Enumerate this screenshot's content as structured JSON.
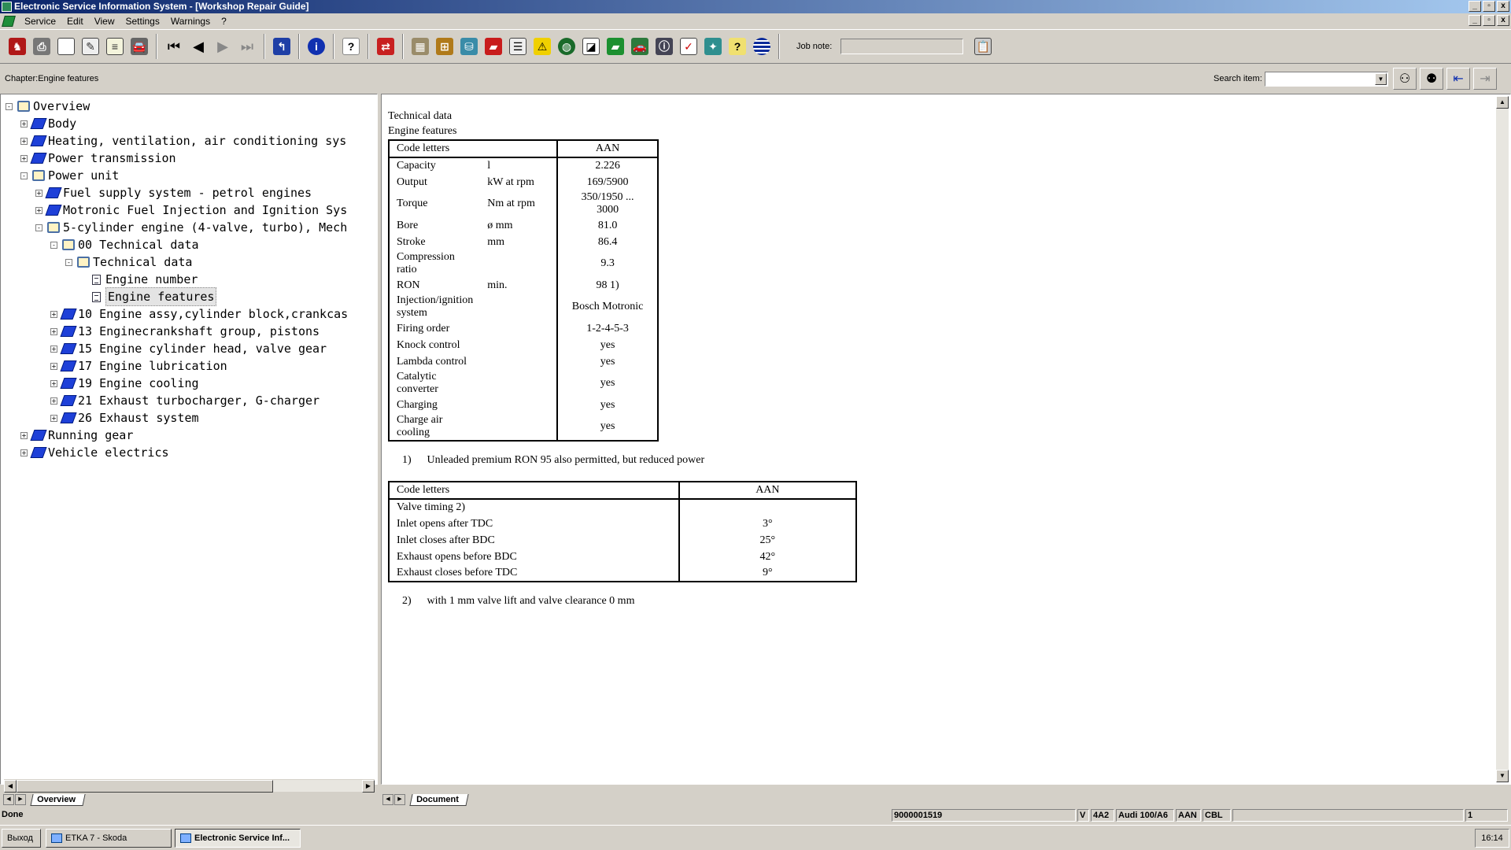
{
  "window": {
    "title": "Electronic Service Information System - [Workshop Repair Guide]",
    "min": "_",
    "restore": "▫",
    "close": "x"
  },
  "menu": [
    "Service",
    "Edit",
    "View",
    "Settings",
    "Warnings",
    "?"
  ],
  "toolbar": {
    "job_note_label": "Job note:",
    "job_note_value": ""
  },
  "chapter_bar": {
    "chapter": "Chapter:Engine features",
    "search_label": "Search item:",
    "search_value": ""
  },
  "tree": [
    {
      "label": "Overview",
      "level": 0,
      "toggle": "-",
      "icon": "open"
    },
    {
      "label": "Body",
      "level": 1,
      "toggle": "+",
      "icon": "closed"
    },
    {
      "label": "Heating, ventilation, air conditioning sys",
      "level": 1,
      "toggle": "+",
      "icon": "closed"
    },
    {
      "label": "Power transmission",
      "level": 1,
      "toggle": "+",
      "icon": "closed"
    },
    {
      "label": "Power unit",
      "level": 1,
      "toggle": "-",
      "icon": "open"
    },
    {
      "label": "Fuel supply system - petrol engines",
      "level": 2,
      "toggle": "+",
      "icon": "closed"
    },
    {
      "label": "Motronic Fuel Injection and Ignition Sys",
      "level": 2,
      "toggle": "+",
      "icon": "closed"
    },
    {
      "label": "5-cylinder engine (4-valve, turbo), Mech",
      "level": 2,
      "toggle": "-",
      "icon": "open"
    },
    {
      "label": "00 Technical data",
      "level": 3,
      "toggle": "-",
      "icon": "open"
    },
    {
      "label": "Technical data",
      "level": 4,
      "toggle": "-",
      "icon": "open"
    },
    {
      "label": "Engine number",
      "level": 5,
      "toggle": "",
      "icon": "doc"
    },
    {
      "label": "Engine features",
      "level": 5,
      "toggle": "",
      "icon": "doc",
      "selected": true
    },
    {
      "label": "10 Engine assy,cylinder block,crankcas",
      "level": 3,
      "toggle": "+",
      "icon": "closed"
    },
    {
      "label": "13 Enginecrankshaft group, pistons",
      "level": 3,
      "toggle": "+",
      "icon": "closed"
    },
    {
      "label": "15 Engine cylinder head, valve gear",
      "level": 3,
      "toggle": "+",
      "icon": "closed"
    },
    {
      "label": "17 Engine lubrication",
      "level": 3,
      "toggle": "+",
      "icon": "closed"
    },
    {
      "label": "19 Engine cooling",
      "level": 3,
      "toggle": "+",
      "icon": "closed"
    },
    {
      "label": "21 Exhaust turbocharger, G-charger",
      "level": 3,
      "toggle": "+",
      "icon": "closed"
    },
    {
      "label": "26 Exhaust system",
      "level": 3,
      "toggle": "+",
      "icon": "closed"
    },
    {
      "label": "Running gear",
      "level": 1,
      "toggle": "+",
      "icon": "closed"
    },
    {
      "label": "Vehicle electrics",
      "level": 1,
      "toggle": "+",
      "icon": "closed"
    }
  ],
  "left_tab": "Overview",
  "right_tab": "Document",
  "document": {
    "heading1": "Technical data",
    "heading2": "Engine features",
    "table1": {
      "header": [
        "Code letters",
        "",
        "AAN"
      ],
      "rows": [
        [
          "Capacity",
          "l",
          "2.226"
        ],
        [
          "Output",
          "kW at rpm",
          "169/5900"
        ],
        [
          "Torque",
          "Nm at rpm",
          "350/1950 ...\n3000"
        ],
        [
          "Bore",
          "ø mm",
          "81.0"
        ],
        [
          "Stroke",
          "mm",
          "86.4"
        ],
        [
          "Compression ratio",
          "",
          "9.3"
        ],
        [
          "RON",
          "min.",
          "98 1)"
        ],
        [
          "Injection/ignition system",
          "",
          "Bosch Motronic"
        ],
        [
          "Firing order",
          "",
          "1-2-4-5-3"
        ],
        [
          "Knock control",
          "",
          "yes"
        ],
        [
          "Lambda control",
          "",
          "yes"
        ],
        [
          "Catalytic converter",
          "",
          "yes"
        ],
        [
          "Charging",
          "",
          "yes"
        ],
        [
          "Charge air cooling",
          "",
          "yes"
        ]
      ]
    },
    "footnote1": {
      "num": "1)",
      "text": "Unleaded premium RON 95 also permitted, but reduced power"
    },
    "table2": {
      "header": [
        "Code letters",
        "AAN"
      ],
      "rows": [
        [
          "Valve timing 2)",
          ""
        ],
        [
          "Inlet opens after TDC",
          "3°"
        ],
        [
          "Inlet closes after BDC",
          "25°"
        ],
        [
          "Exhaust opens before BDC",
          "42°"
        ],
        [
          "Exhaust closes before TDC",
          "9°"
        ]
      ]
    },
    "footnote2": {
      "num": "2)",
      "text": "with 1 mm valve lift and valve clearance 0 mm"
    }
  },
  "status": {
    "text": "Done",
    "doc_id": "9000001519",
    "flag": "V",
    "model_code": "4A2",
    "model": "Audi 100/A6",
    "engine": "AAN",
    "gearbox": "CBL",
    "page": "1"
  },
  "taskbar": {
    "start": "Выход",
    "task1": "ETKA 7 - Skoda",
    "task2": "Electronic Service Inf...",
    "clock": "16:14"
  }
}
